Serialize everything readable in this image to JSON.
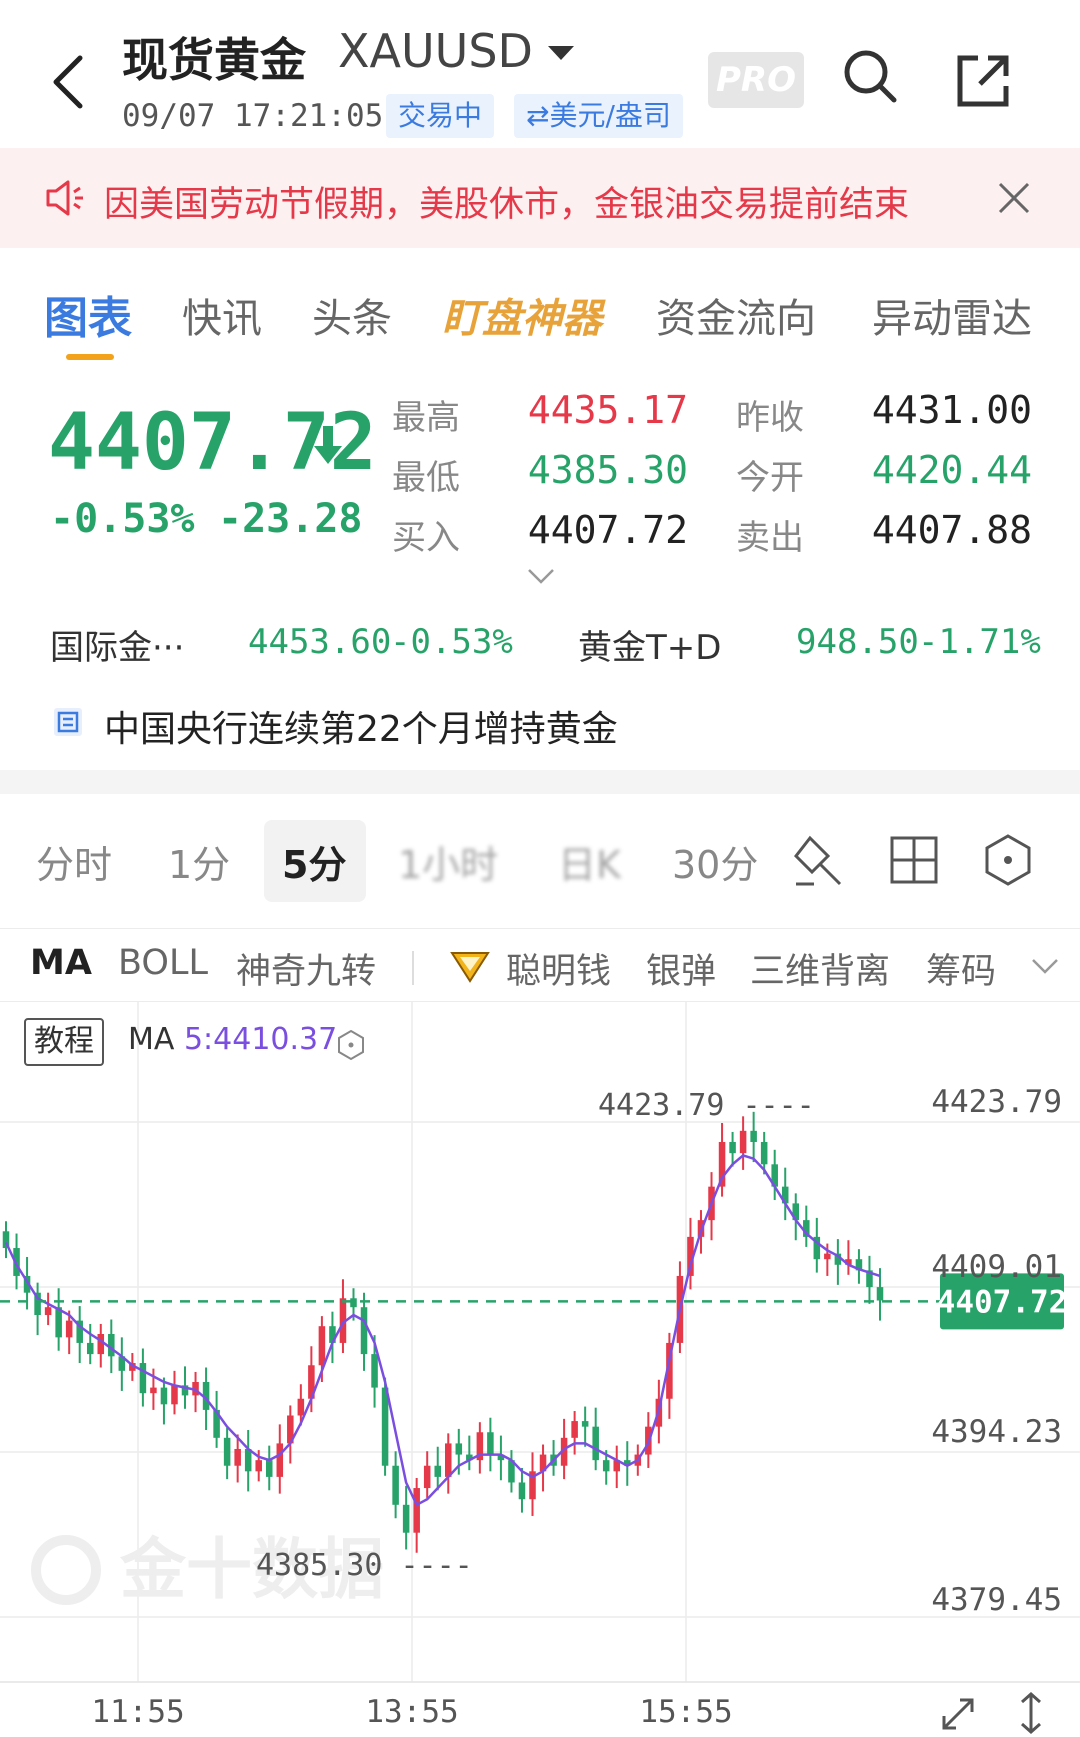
{
  "header": {
    "title": "现货黄金",
    "symbol": "XAUUSD",
    "datetime": "09/07 17:21:05",
    "status_tag": "交易中",
    "currency_tag": "⇄美元/盎司",
    "pro_badge": "PRO",
    "icons": [
      "back-icon",
      "caret-down-icon",
      "search-icon",
      "share-icon"
    ]
  },
  "notice": {
    "text": "因美国劳动节假期，美股休市，金银油交易提前结束",
    "icons": [
      "speaker-icon",
      "close-icon"
    ]
  },
  "tabs": [
    "图表",
    "快讯",
    "头条",
    "盯盘神器",
    "资金流向",
    "异动雷达"
  ],
  "quote": {
    "price": "4407.72",
    "change_pct": "-0.53%",
    "change": "-23.28",
    "high_label": "最高",
    "high": "4435.17",
    "low_label": "最低",
    "low": "4385.30",
    "bid_label": "买入",
    "bid": "4407.72",
    "prev_close_label": "昨收",
    "prev_close": "4431.00",
    "open_label": "今开",
    "open": "4420.44",
    "ask_label": "卖出",
    "ask": "4407.88"
  },
  "related": [
    {
      "name": "国际金···",
      "price": "4453.60",
      "pct": "-0.53%"
    },
    {
      "name": "黄金T+D",
      "price": "948.50",
      "pct": "-1.71%"
    }
  ],
  "news": {
    "text": "中国央行连续第22个月增持黄金"
  },
  "periods": [
    "分时",
    "1分",
    "5分",
    "1小时",
    "日K",
    "30分"
  ],
  "active_period": "5分",
  "indicators": [
    "MA",
    "BOLL",
    "神奇九转",
    "聪明钱",
    "银弹",
    "三维背离",
    "筹码"
  ],
  "chart": {
    "tutorial": "教程",
    "ma_label": "MA ",
    "ma_value": "5:4410.37",
    "y_labels": [
      "4423.79",
      "4409.01",
      "4394.23",
      "4379.45"
    ],
    "x_labels": [
      "11:55",
      "13:55",
      "15:55"
    ],
    "high_marker": "4423.79 ----",
    "low_marker": "4385.30 ----",
    "last_price": "4407.72",
    "watermark": "金十数据",
    "colors": {
      "up": "#e5394a",
      "down": "#27a36a",
      "ma": "#7a4fe0"
    }
  },
  "chart_data": {
    "type": "candlestick",
    "x_labels": [
      "11:55",
      "13:55",
      "15:55"
    ],
    "ylim": [
      4379.45,
      4430
    ],
    "y_ticks": [
      4423.79,
      4409.01,
      4394.23,
      4379.45
    ],
    "last_price": 4407.72,
    "high": 4423.79,
    "low": 4385.3,
    "close_series": [
      4412.5,
      4410.0,
      4408.5,
      4406.5,
      4407.2,
      4404.5,
      4406.0,
      4404.0,
      4403.0,
      4404.8,
      4402.8,
      4401.5,
      4402.2,
      4399.5,
      4400.0,
      4398.5,
      4400.2,
      4399.3,
      4400.5,
      4398.0,
      4395.5,
      4393.0,
      4394.5,
      4392.5,
      4393.5,
      4392.0,
      4395.0,
      4397.5,
      4399.0,
      4402.0,
      4405.5,
      4404.0,
      4408.0,
      4407.2,
      4403.0,
      4400.0,
      4393.0,
      4389.5,
      4387.0,
      4391.0,
      4393.0,
      4392.0,
      4395.0,
      4394.0,
      4393.5,
      4396.0,
      4394.0,
      4393.5,
      4391.5,
      4390.0,
      4392.5,
      4394.0,
      4393.0,
      4395.5,
      4397.0,
      4396.5,
      4393.5,
      4392.5,
      4393.5,
      4393.0,
      4394.0,
      4396.5,
      4399.0,
      4404.0,
      4410.0,
      4413.5,
      4415.0,
      4418.0,
      4422.0,
      4421.0,
      4423.0,
      4422.0,
      4420.0,
      4418.0,
      4416.5,
      4415.0,
      4413.5,
      4411.5,
      4412.0,
      4411.0,
      4411.5,
      4410.5,
      4409.0,
      4407.8
    ],
    "ma_series": [
      4413.0,
      4411.0,
      4409.5,
      4408.0,
      4407.5,
      4407.0,
      4406.5,
      4405.5,
      4404.8,
      4404.2,
      4403.5,
      4402.8,
      4402.0,
      4401.5,
      4401.0,
      4400.5,
      4400.2,
      4400.0,
      4399.8,
      4399.0,
      4397.8,
      4396.5,
      4395.5,
      4394.5,
      4393.8,
      4393.5,
      4394.0,
      4395.0,
      4396.8,
      4399.0,
      4401.5,
      4404.0,
      4405.8,
      4406.5,
      4406.0,
      4404.0,
      4400.5,
      4396.0,
      4391.5,
      4389.5,
      4390.0,
      4391.0,
      4392.0,
      4393.0,
      4393.5,
      4394.0,
      4394.0,
      4394.0,
      4393.5,
      4392.5,
      4392.0,
      4392.5,
      4393.5,
      4394.5,
      4395.0,
      4395.0,
      4394.5,
      4394.0,
      4393.5,
      4393.0,
      4393.5,
      4395.0,
      4398.0,
      4402.5,
      4407.0,
      4411.0,
      4414.0,
      4416.5,
      4418.8,
      4420.0,
      4420.8,
      4420.5,
      4419.5,
      4418.0,
      4416.5,
      4415.0,
      4413.8,
      4413.0,
      4412.3,
      4411.8,
      4411.0,
      4410.6,
      4410.3,
      4410.0
    ]
  }
}
